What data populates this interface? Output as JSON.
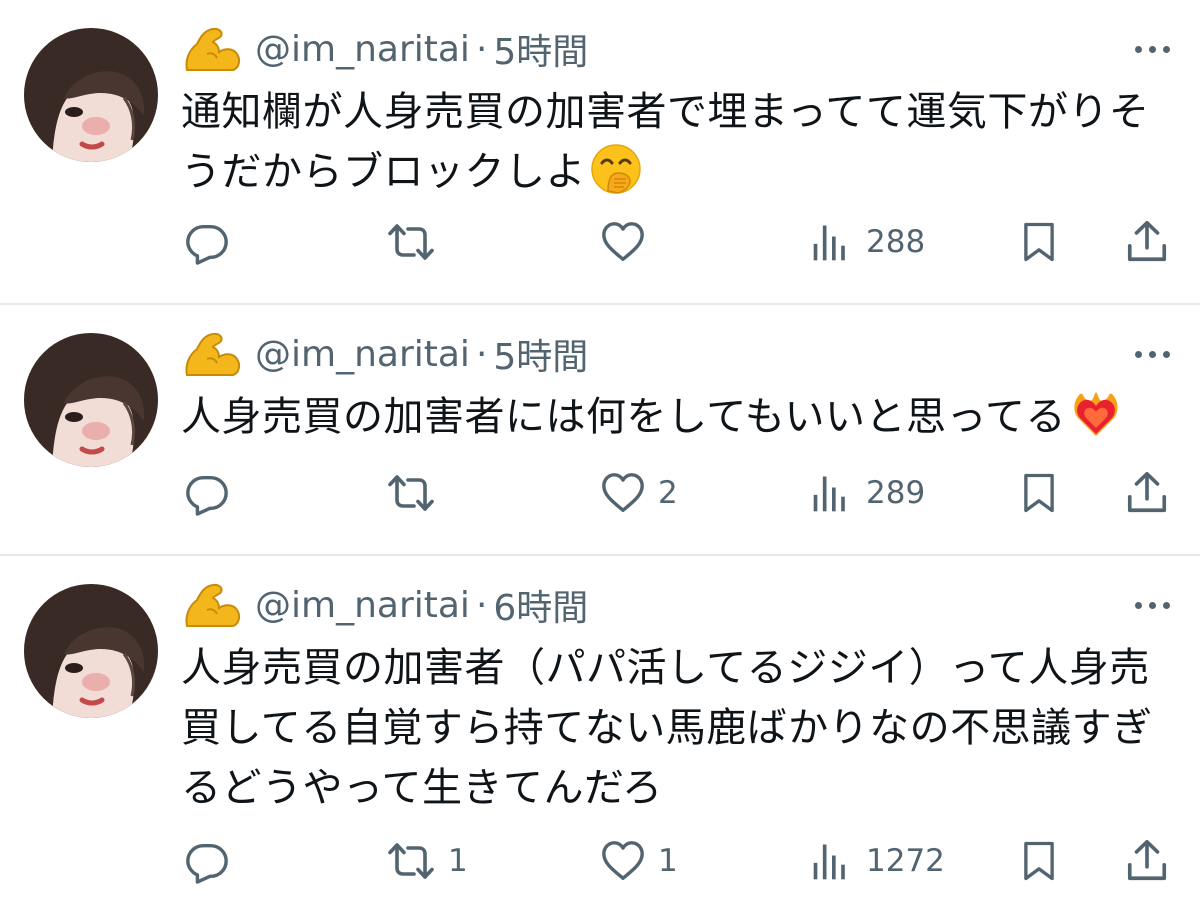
{
  "colors": {
    "text_primary": "#0f1419",
    "text_secondary": "#536471",
    "divider": "#e6e9eb"
  },
  "tweets": [
    {
      "handle": "@im_naritai",
      "separator": "·",
      "time": "5時間",
      "text": "通知欄が人身売買の加害者で埋まってて運気下がりそうだからブロックしよ",
      "emoji": "face-with-hand-over-mouth",
      "reply_count": "",
      "retweet_count": "",
      "like_count": "",
      "view_count": "288"
    },
    {
      "handle": "@im_naritai",
      "separator": "·",
      "time": "5時間",
      "text": "人身売買の加害者には何をしてもいいと思ってる",
      "emoji": "heart-on-fire",
      "reply_count": "",
      "retweet_count": "",
      "like_count": "2",
      "view_count": "289"
    },
    {
      "handle": "@im_naritai",
      "separator": "·",
      "time": "6時間",
      "text": "人身売買の加害者（パパ活してるジジイ）って人身売買してる自覚すら持てない馬鹿ばかりなの不思議すぎるどうやって生きてんだろ",
      "emoji": "",
      "reply_count": "",
      "retweet_count": "1",
      "like_count": "1",
      "view_count": "1272"
    }
  ],
  "icons": {
    "badge": "flexed-biceps-emoji",
    "more": "more-dots-icon",
    "reply": "reply-icon",
    "retweet": "retweet-icon",
    "like": "like-icon",
    "views": "views-icon",
    "bookmark": "bookmark-icon",
    "share": "share-icon"
  }
}
